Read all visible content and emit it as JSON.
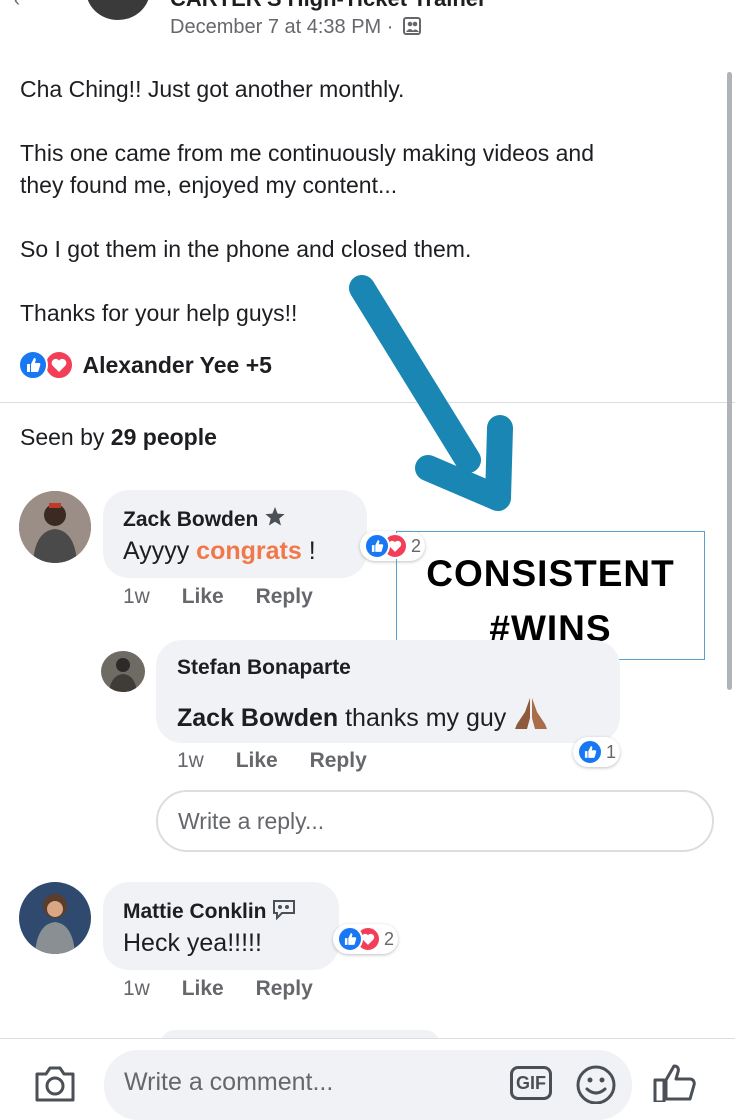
{
  "post": {
    "group_name": "CARTER'S High-Ticket Trainer",
    "timestamp": "December 7 at 4:38 PM ·",
    "lines": [
      "Cha Ching!! Just got another monthly.",
      "This one came from me continuously making videos and",
      "they found me, enjoyed my content...",
      "So I got them in the phone and closed them.",
      "Thanks for your help guys!!"
    ],
    "reactors": "Alexander Yee +5",
    "seen_prefix": "Seen by",
    "seen_count": "29 people"
  },
  "annotation": {
    "line1": "CONSISTENT",
    "line2": "#WINS"
  },
  "comments": [
    {
      "name": "Zack Bowden",
      "text_before": "Ayyyy ",
      "text_highlight": "congrats",
      "text_after": " !",
      "reaction_count": "2",
      "time": "1w",
      "like": "Like",
      "reply": "Reply",
      "replies": [
        {
          "name": "Stefan Bonaparte",
          "mention": "Zack Bowden",
          "text": " thanks my guy",
          "reaction_count": "1",
          "time": "1w",
          "like": "Like",
          "reply": "Reply"
        }
      ]
    },
    {
      "name": "Mattie Conklin",
      "text": "Heck yea!!!!!",
      "reaction_count": "2",
      "time": "1w",
      "like": "Like",
      "reply": "Reply"
    }
  ],
  "reply_placeholder": "Write a reply...",
  "comment_placeholder": "Write a comment...",
  "gif_label": "GIF",
  "colors": {
    "like": "#1877f2",
    "love": "#f33e58",
    "accent_text": "#f0784a",
    "arrow": "#1a86b3"
  }
}
